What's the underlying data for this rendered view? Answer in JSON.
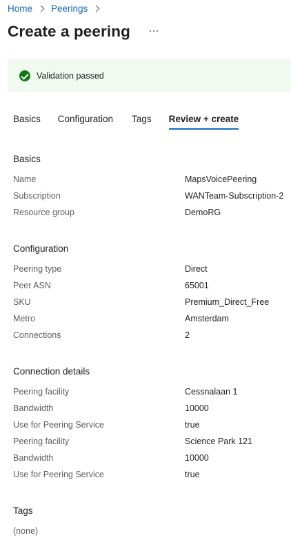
{
  "breadcrumb": {
    "items": [
      "Home",
      "Peerings"
    ]
  },
  "page": {
    "title": "Create a peering",
    "more_icon": "ellipsis-icon"
  },
  "banner": {
    "icon": "checkmark-circle-icon",
    "text": "Validation passed",
    "color": "#0f7b0f",
    "background": "#f1faf1"
  },
  "tabs": [
    {
      "label": "Basics",
      "active": false
    },
    {
      "label": "Configuration",
      "active": false
    },
    {
      "label": "Tags",
      "active": false
    },
    {
      "label": "Review + create",
      "active": true
    }
  ],
  "accent_color": "#0f6cbd",
  "sections": {
    "basics": {
      "title": "Basics",
      "rows": [
        {
          "label": "Name",
          "value": "MapsVoicePeering"
        },
        {
          "label": "Subscription",
          "value": "WANTeam-Subscription-2"
        },
        {
          "label": "Resource group",
          "value": "DemoRG"
        }
      ]
    },
    "configuration": {
      "title": "Configuration",
      "rows": [
        {
          "label": "Peering type",
          "value": "Direct"
        },
        {
          "label": "Peer ASN",
          "value": "65001"
        },
        {
          "label": "SKU",
          "value": "Premium_Direct_Free"
        },
        {
          "label": "Metro",
          "value": "Amsterdam"
        },
        {
          "label": "Connections",
          "value": "2"
        }
      ]
    },
    "connection_details": {
      "title": "Connection details",
      "rows": [
        {
          "label": "Peering facility",
          "value": "Cessnalaan 1"
        },
        {
          "label": "Bandwidth",
          "value": "10000"
        },
        {
          "label": "Use for Peering Service",
          "value": "true"
        },
        {
          "label": "Peering facility",
          "value": "Science Park 121"
        },
        {
          "label": "Bandwidth",
          "value": "10000"
        },
        {
          "label": "Use for Peering Service",
          "value": "true"
        }
      ]
    },
    "tags": {
      "title": "Tags",
      "empty_text": "(none)"
    }
  }
}
